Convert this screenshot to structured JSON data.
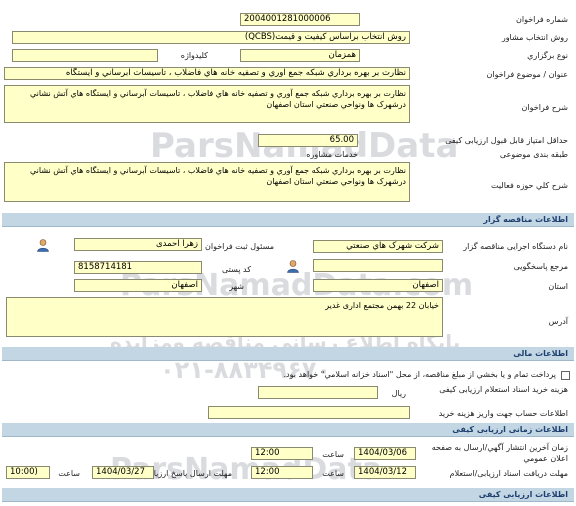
{
  "section1": {
    "rows": {
      "tender_number": {
        "label": "شماره فراخوان",
        "value": "2004001281000006"
      },
      "selection_method": {
        "label": "روش انتخاب مشاور",
        "value": "روش انتخاب براساس کیفیت و قیمت(QCBS)"
      },
      "holding_type": {
        "label": "نوع برگزاري",
        "value": "همزمان",
        "label2": "کلیدواژه",
        "value2": ""
      },
      "title": {
        "label": "عنوان / موضوع فراخوان",
        "value": "نظارت بر بهره برداري شبکه جمع آوري و تصفیه خانه هاي فاضلاب ، تاسیسات آبرساني و ایستگاه"
      },
      "description": {
        "label": "شرح فراخوان",
        "value": "نظارت بر بهره برداري شبکه جمع آوري و تصفیه خانه هاي فاضلاب ، تاسیسات آبرساني و ایستگاه هاي آتش نشاني  درشهرک ها ونواحي صنعتي استان اصفهان"
      },
      "min_score": {
        "label": "حداقل امتیاز قابل قبول ارزیابی کیفی",
        "value": "65.00"
      },
      "category": {
        "label": "طبقه بندی موضوعی",
        "value": "خدمات مشاوره"
      },
      "activity_description": {
        "label": "شرح کلي حوزه فعالیت",
        "value": "نظارت بر بهره برداري شبکه جمع آوري و تصفیه خانه هاي فاضلاب ، تاسیسات آبرساني و ایستگاه هاي آتش نشاني  درشهرک ها ونواحي صنعتي استان اصفهان"
      }
    }
  },
  "section2": {
    "header": "اطلاعات مناقصه گزار",
    "agency": {
      "label": "نام دستگاه اجرایی مناقصه گزار",
      "value": "شرکت شهرک هاي صنعتي"
    },
    "registrar": {
      "label": "مسئول ثبت فراخوان",
      "value": "زهرا احمدی"
    },
    "reference": {
      "label": "مرجع پاسخگویی",
      "value": ""
    },
    "postal_code": {
      "label": "کد پستی",
      "value": "8158714181"
    },
    "province": {
      "label": "استان",
      "value": "اصفهان"
    },
    "city": {
      "label": "شهر",
      "value": "اصفهان"
    },
    "address": {
      "label": "آدرس",
      "value": "خیابان 22 بهمن مجتمع اداری غدیر"
    }
  },
  "section3": {
    "header": "اطلاعات مالی",
    "payment_note": "پرداخت تمام و یا بخشي از مبلغ مناقصه، از محل \"اسناد خزانه اسلامي\" خواهد بود.",
    "purchase_fee": {
      "label": "هزینه خرید اسناد استعلام ارزیابی کیفی",
      "value": "",
      "currency": "ریال"
    },
    "account_info": {
      "label": "اطلاعات حساب جهت واریز هزینه خرید",
      "value": ""
    }
  },
  "section4": {
    "header": "اطلاعات زمانی ارزیابی کیفی",
    "publish_date": {
      "label": "زمان آخرین انتشار آگهي/ارسال به صفحه اعلان عمومي",
      "date": "1404/03/06",
      "time_label": "ساعت",
      "time": "12:00"
    },
    "receive_deadline": {
      "label": "مهلت دریافت اسناد ارزیابی/استعلام",
      "date": "1404/03/12",
      "time_label": "ساعت",
      "time": "12:00"
    },
    "submit_deadline": {
      "label": "مهلت ارسال پاسخ ارزیابی/استعلام",
      "date": "1404/03/27",
      "time_label": "ساعت",
      "time": "10:00)"
    }
  },
  "section5": {
    "header": "اطلاعات ارزیابی کیفی"
  },
  "watermark": {
    "phone_large": "021-88349670",
    "line1": "ParsNamadData",
    "line2": "مرکز فراوری اطلاعات پارس نماد داده",
    "line3": "پایگاه اطلاع رسانی مناقصه ومزایده",
    "phone_small": "۰۲۱-۸۸۳۴۹۶۷۰",
    "site": "ParsNamadData.com"
  },
  "colors": {
    "field_bg": "#ffffc8",
    "section_bg": "#c2d6e4",
    "section_text": "#1f3f6e"
  }
}
